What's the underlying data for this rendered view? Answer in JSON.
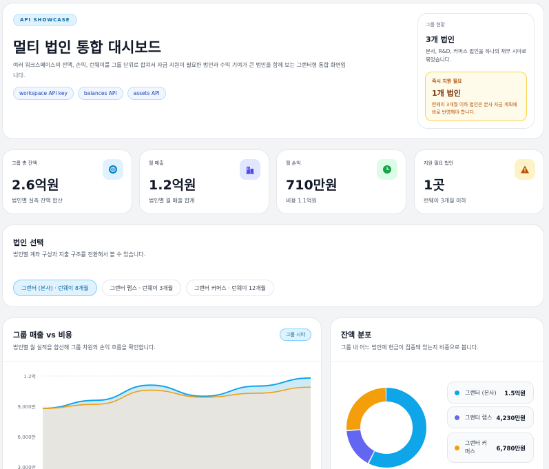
{
  "hero": {
    "badge": "API SHOWCASE",
    "title": "멀티 법인 통합 대시보드",
    "description": "여러 워크스페이스의 잔액, 손익, 런웨이를 그룹 단위로 합쳐서 자금 지원이 필요한 법인과 수익 기여가 큰 법인을 함께 보는 그랜터형 통합 화면입니다.",
    "chips": [
      "workspace API key",
      "balances API",
      "assets API"
    ]
  },
  "group_status": {
    "label": "그룹 현황",
    "value": "3개 법인",
    "sub": "본사, R&D, 커머스 법인을 하나의 재무 시야로 묶었습니다.",
    "alert": {
      "label": "즉시 지원 필요",
      "value": "1개 법인",
      "sub": "런웨이 3개월 이하 법인은 본사 자금 계획에 바로 반영해야 합니다."
    }
  },
  "stats": [
    {
      "label": "그룹 총 잔액",
      "value": "2.6억원",
      "sub": "법인별 실측 잔액 합산",
      "icon": "coin-icon",
      "icon_bg": "#e0f2fe",
      "icon_color": "#0284c7"
    },
    {
      "label": "월 매출",
      "value": "1.2억원",
      "sub": "법인별 월 매출 합계",
      "icon": "building-icon",
      "icon_bg": "#e0e7ff",
      "icon_color": "#4f46e5"
    },
    {
      "label": "월 손익",
      "value": "710만원",
      "sub": "비용 1.1억원",
      "icon": "clock-icon",
      "icon_bg": "#dcfce7",
      "icon_color": "#16a34a"
    },
    {
      "label": "지원 필요 법인",
      "value": "1곳",
      "sub": "런웨이 3개월 이하",
      "icon": "warning-icon",
      "icon_bg": "#fef3c7",
      "icon_color": "#b45309"
    }
  ],
  "filter": {
    "title": "법인 선택",
    "sub": "법인별 계좌 구성과 지출 구조를 전환해서 볼 수 있습니다.",
    "options": [
      "그랜터 (본사) · 런웨이 8개월",
      "그랜터 랩스 · 런웨이 3개월",
      "그랜터 커머스 · 런웨이 12개월"
    ],
    "selected": 0
  },
  "revenue_chart": {
    "title": "그룹 매출 vs 비용",
    "sub": "법인별 월 실적을 합산해 그룹 차원의 손익 흐름을 확인합니다.",
    "badge": "그룹 시야",
    "colors": {
      "revenue": "#0ea5e9",
      "cost": "#f59e0b"
    }
  },
  "chart_data": {
    "type": "area",
    "y_tick_labels": [
      "1.2억",
      "9,000만",
      "6,000만",
      "3,000만"
    ],
    "y_ticks": [
      120000000,
      90000000,
      60000000,
      30000000
    ],
    "ylim": [
      0,
      120000000
    ],
    "series": [
      {
        "values": [
          88000000,
          96000000,
          111000000,
          100000000,
          110000000,
          118000000
        ]
      },
      {
        "values": [
          88000000,
          92000000,
          106000000,
          99000000,
          103000000,
          109000000
        ]
      }
    ]
  },
  "balance": {
    "title": "잔액 분포",
    "sub": "그룹 내 어느 법인에 현금이 집중돼 있는지 비중으로 봅니다.",
    "items": [
      {
        "name": "그랜터 (본사)",
        "value": "1.5억원",
        "amount": 150000000,
        "color": "#0ea5e9"
      },
      {
        "name": "그랜터 랩스",
        "value": "4,230만원",
        "amount": 42300000,
        "color": "#6366f1"
      },
      {
        "name": "그랜터 커머스",
        "value": "6,780만원",
        "amount": 67800000,
        "color": "#f59e0b"
      }
    ]
  }
}
